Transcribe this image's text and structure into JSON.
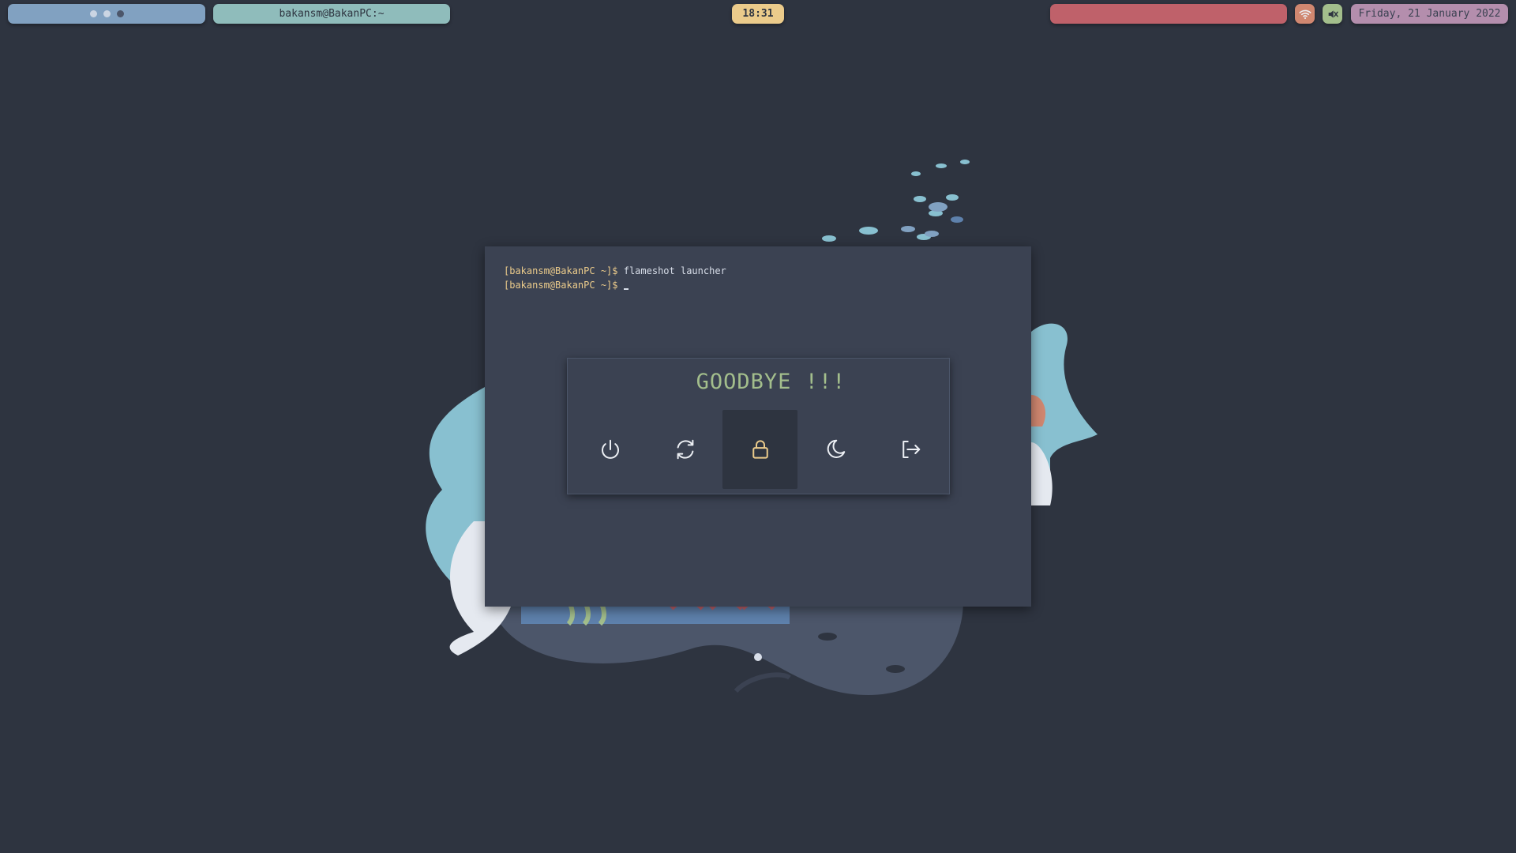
{
  "topbar": {
    "window_title": "bakansm@BakanPC:~",
    "clock": "18:31",
    "date": "Friday, 21 January 2022",
    "workspaces": [
      "workspace-1",
      "workspace-2",
      "workspace-3"
    ],
    "active_workspace": 3,
    "icons": {
      "wifi": "wifi-icon",
      "mute": "speaker-muted-icon"
    },
    "colors": {
      "workspaces": "#81a1c1",
      "window_title": "#8fbcbb",
      "clock": "#ebcb8b",
      "tray": "#bf616a",
      "wifi": "#d08770",
      "mute": "#a3be8c",
      "date": "#b48ead"
    }
  },
  "terminal": {
    "lines": [
      {
        "prompt": "[bakansm@BakanPC ~]$",
        "command": " flameshot launcher"
      },
      {
        "prompt": "[bakansm@BakanPC ~]$",
        "command": " "
      }
    ],
    "colors": {
      "background": "#3b4252",
      "prompt": "#ebcb8b",
      "text": "#d8dee9"
    }
  },
  "power_menu": {
    "title": "GOODBYE !!!",
    "options": [
      {
        "icon": "power-icon",
        "selected": false
      },
      {
        "icon": "reboot-icon",
        "selected": false
      },
      {
        "icon": "lock-icon",
        "selected": true
      },
      {
        "icon": "suspend-icon",
        "selected": false
      },
      {
        "icon": "logout-icon",
        "selected": false
      }
    ],
    "colors": {
      "title": "#a3be8c",
      "icon": "#eceff4",
      "selected_icon": "#ebcb8b"
    }
  },
  "desktop": {
    "background": "#2e3440"
  }
}
